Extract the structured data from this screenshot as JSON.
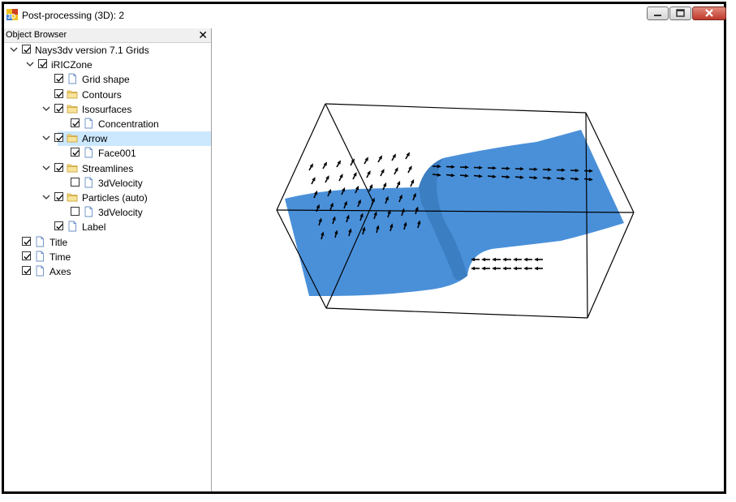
{
  "window": {
    "title": "Post-processing (3D): 2",
    "app_icon": "3d-app-icon",
    "buttons": [
      "minimize-icon",
      "maximize-icon",
      "close-icon"
    ]
  },
  "object_browser": {
    "title": "Object Browser",
    "close_glyph": "✕",
    "items": [
      {
        "label": "Nays3dv version 7.1 Grids",
        "level": 0,
        "expander": "expanded",
        "checked": true,
        "icon": "none",
        "selected": false
      },
      {
        "label": "iRICZone",
        "level": 1,
        "expander": "expanded",
        "checked": true,
        "icon": "none",
        "selected": false
      },
      {
        "label": "Grid shape",
        "level": 2,
        "expander": "none",
        "checked": true,
        "icon": "file-icon",
        "selected": false
      },
      {
        "label": "Contours",
        "level": 2,
        "expander": "none",
        "checked": true,
        "icon": "folder-icon",
        "selected": false
      },
      {
        "label": "Isosurfaces",
        "level": 2,
        "expander": "expanded",
        "checked": true,
        "icon": "folder-icon",
        "selected": false
      },
      {
        "label": "Concentration",
        "level": 3,
        "expander": "none",
        "checked": true,
        "icon": "file-icon",
        "selected": false
      },
      {
        "label": "Arrow",
        "level": 2,
        "expander": "expanded",
        "checked": true,
        "icon": "folder-icon",
        "selected": true
      },
      {
        "label": "Face001",
        "level": 3,
        "expander": "none",
        "checked": true,
        "icon": "file-icon",
        "selected": false
      },
      {
        "label": "Streamlines",
        "level": 2,
        "expander": "expanded",
        "checked": true,
        "icon": "folder-icon",
        "selected": false
      },
      {
        "label": "3dVelocity",
        "level": 3,
        "expander": "none",
        "checked": false,
        "icon": "file-icon",
        "selected": false
      },
      {
        "label": "Particles (auto)",
        "level": 2,
        "expander": "expanded",
        "checked": true,
        "icon": "folder-icon",
        "selected": false
      },
      {
        "label": "3dVelocity",
        "level": 3,
        "expander": "none",
        "checked": false,
        "icon": "file-icon",
        "selected": false
      },
      {
        "label": "Label",
        "level": 2,
        "expander": "none",
        "checked": true,
        "icon": "file-icon",
        "selected": false
      },
      {
        "label": "Title",
        "level": 0,
        "expander": "none",
        "checked": true,
        "icon": "file-icon",
        "selected": false
      },
      {
        "label": "Time",
        "level": 0,
        "expander": "none",
        "checked": true,
        "icon": "file-icon",
        "selected": false
      },
      {
        "label": "Axes",
        "level": 0,
        "expander": "none",
        "checked": true,
        "icon": "file-icon",
        "selected": false
      }
    ]
  },
  "viewport": {
    "surface_color": "#4a90d9",
    "selection_color": "#cce8ff",
    "arrow_color": "#000000"
  }
}
